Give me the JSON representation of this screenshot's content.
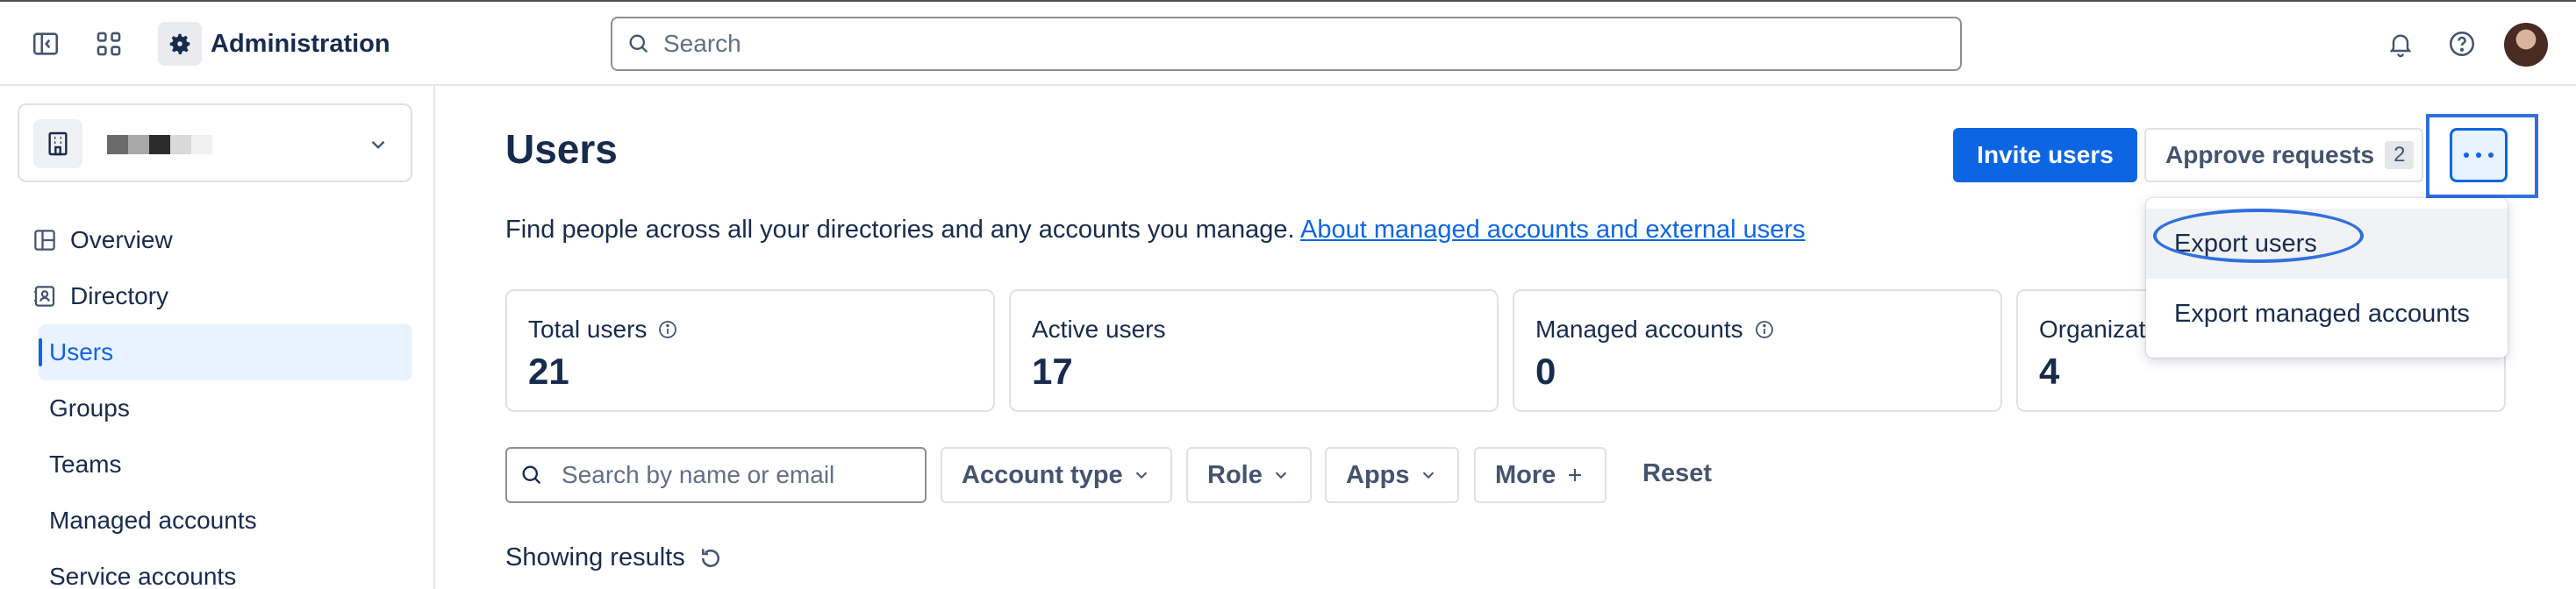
{
  "header": {
    "app_title": "Administration",
    "search_placeholder": "Search",
    "icons": [
      "sidebar-toggle-icon",
      "app-switcher-icon",
      "gear-icon",
      "search-icon",
      "bell-icon",
      "help-icon",
      "avatar"
    ]
  },
  "sidebar": {
    "org_icon": "building-icon",
    "org_name_redacted_colors": [
      "#6b6b6b",
      "#a8a8a8",
      "#2c2c2c",
      "#d9d9d9",
      "#f0f0f0"
    ],
    "items": [
      {
        "label": "Overview",
        "icon": "overview-icon"
      },
      {
        "label": "Directory",
        "icon": "directory-icon"
      }
    ],
    "sub_items": [
      {
        "label": "Users",
        "active": true
      },
      {
        "label": "Groups"
      },
      {
        "label": "Teams"
      },
      {
        "label": "Managed accounts"
      },
      {
        "label": "Service accounts"
      }
    ]
  },
  "main": {
    "title": "Users",
    "invite_label": "Invite users",
    "approve_label": "Approve requests",
    "approve_count": "2",
    "description": "Find people across all your directories and any accounts you manage.",
    "description_link": "About managed accounts and external users",
    "stats": [
      {
        "label": "Total users",
        "value": "21",
        "info": true
      },
      {
        "label": "Active users",
        "value": "17",
        "info": false
      },
      {
        "label": "Managed accounts",
        "value": "0",
        "info": true
      },
      {
        "label": "Organizat",
        "value": "4",
        "info": false
      }
    ],
    "filters": {
      "search_placeholder": "Search by name or email",
      "account_type": "Account type",
      "role": "Role",
      "apps": "Apps",
      "more": "More",
      "reset": "Reset"
    },
    "showing": "Showing results"
  },
  "dropdown": {
    "items": [
      {
        "label": "Export users"
      },
      {
        "label": "Export managed accounts"
      }
    ]
  },
  "colors": {
    "primary": "#0c66e4",
    "annotation": "#2f6fe0"
  }
}
